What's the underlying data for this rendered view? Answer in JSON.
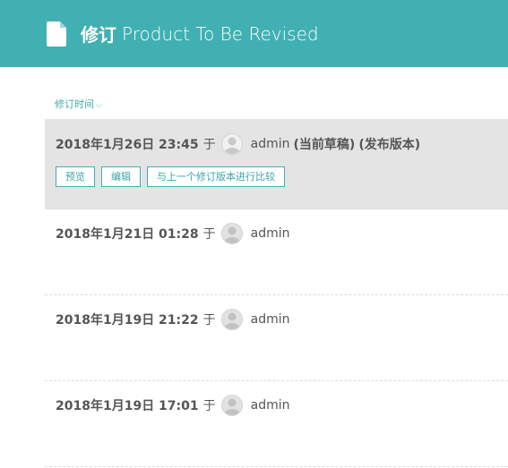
{
  "header": {
    "prefix": "修订",
    "title": "Product To Be Revised",
    "icon": "document-icon"
  },
  "sort": {
    "label": "修订时间",
    "caret": "⌵"
  },
  "revisions": [
    {
      "date": "2018年1月26日 23:45",
      "at": "于",
      "user": "admin",
      "tag1": "(当前草稿)",
      "tag2": "(发布版本)",
      "actions": [
        "预览",
        "编辑",
        "与上一个修订版本进行比较"
      ]
    },
    {
      "date": "2018年1月21日 01:28",
      "at": "于",
      "user": "admin"
    },
    {
      "date": "2018年1月19日 21:22",
      "at": "于",
      "user": "admin"
    },
    {
      "date": "2018年1月19日 17:01",
      "at": "于",
      "user": "admin"
    }
  ],
  "colors": {
    "accent": "#40b0b2",
    "current_bg": "#e4e4e4"
  }
}
